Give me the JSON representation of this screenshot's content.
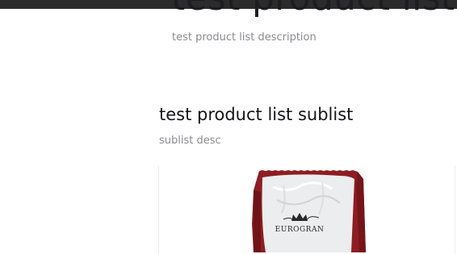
{
  "page": {
    "title": "test product list",
    "description": "test product list description"
  },
  "sublist": {
    "title": "test product list sublist",
    "description": "sublist desc"
  },
  "product": {
    "image_label": "product-packet-image",
    "brand": "EUROGRAN"
  },
  "colors": {
    "packet_red": "#8e1d22",
    "packet_silver": "#ecedee",
    "title_text": "#1c1c22",
    "muted_text": "#8a8a92"
  }
}
